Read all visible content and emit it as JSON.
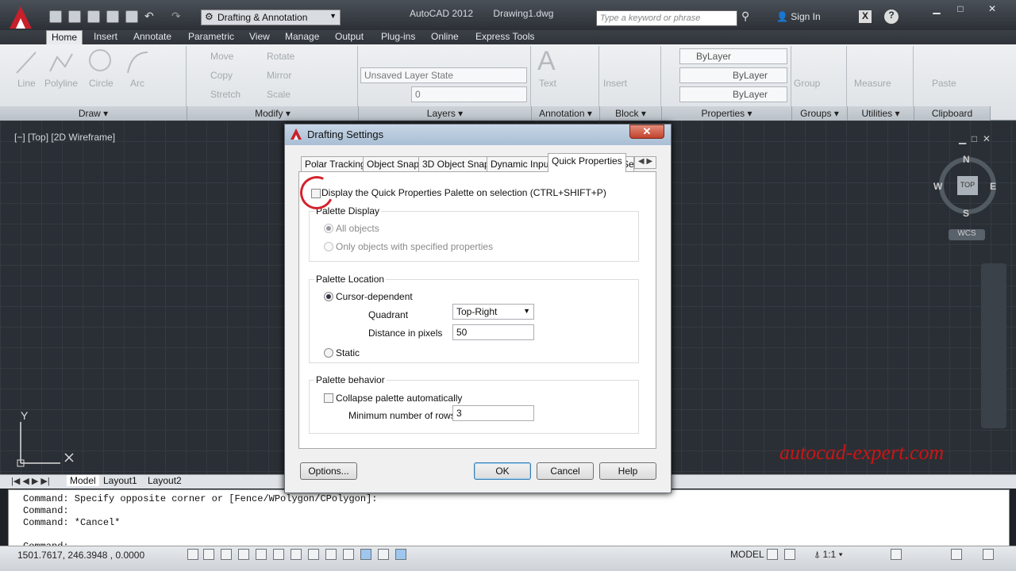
{
  "titlebar": {
    "workspace": "Drafting & Annotation",
    "app_title": "AutoCAD 2012",
    "file_name": "Drawing1.dwg",
    "search_placeholder": "Type a keyword or phrase",
    "sign_in": "Sign In"
  },
  "menu_tabs": [
    "Home",
    "Insert",
    "Annotate",
    "Parametric",
    "View",
    "Manage",
    "Output",
    "Plug-ins",
    "Online",
    "Express Tools"
  ],
  "ribbon": {
    "draw": {
      "line": "Line",
      "polyline": "Polyline",
      "circle": "Circle",
      "arc": "Arc",
      "title": "Draw"
    },
    "modify": {
      "move": "Move",
      "rotate": "Rotate",
      "copy": "Copy",
      "mirror": "Mirror",
      "stretch": "Stretch",
      "scale": "Scale",
      "title": "Modify"
    },
    "layers": {
      "layer_state": "Unsaved Layer State",
      "layer_value": "0",
      "title": "Layers"
    },
    "annotation": {
      "text": "Text",
      "title": "Annotation"
    },
    "block": {
      "insert": "Insert",
      "title": "Block"
    },
    "properties": {
      "color": "ByLayer",
      "linetype": "ByLayer",
      "lineweight": "ByLayer",
      "title": "Properties"
    },
    "groups": {
      "group": "Group",
      "title": "Groups"
    },
    "utilities": {
      "measure": "Measure",
      "title": "Utilities"
    },
    "clipboard": {
      "paste": "Paste",
      "title": "Clipboard"
    }
  },
  "viewport": {
    "label": "[−] [Top] [2D Wireframe]",
    "compass": {
      "n": "N",
      "s": "S",
      "e": "E",
      "w": "W",
      "top": "TOP",
      "wcs": "WCS"
    },
    "axis_y": "Y"
  },
  "layout_tabs": [
    "Model",
    "Layout1",
    "Layout2"
  ],
  "command_lines": [
    "Command: Specify opposite corner or [Fence/WPolygon/CPolygon]:",
    "Command:",
    "Command: *Cancel*",
    "",
    "Command:"
  ],
  "statusbar": {
    "coords": "1501.7617, 246.3948 , 0.0000",
    "model": "MODEL",
    "scale": "1:1"
  },
  "watermark": "autocad-expert.com",
  "dialog": {
    "title": "Drafting Settings",
    "close": "✕",
    "tabs": [
      "Polar Tracking",
      "Object Snap",
      "3D Object Snap",
      "Dynamic Input",
      "Quick Properties",
      "Se"
    ],
    "active_tab": "Quick Properties",
    "display_checkbox": "Display the Quick Properties Palette on selection (CTRL+SHIFT+P)",
    "palette_display": {
      "title": "Palette Display",
      "all_objects": "All objects",
      "only_specified": "Only objects with specified properties"
    },
    "palette_location": {
      "title": "Palette Location",
      "cursor_dependent": "Cursor-dependent",
      "quadrant_label": "Quadrant",
      "quadrant_value": "Top-Right",
      "distance_label": "Distance in pixels",
      "distance_value": "50",
      "static": "Static"
    },
    "palette_behavior": {
      "title": "Palette behavior",
      "collapse": "Collapse palette automatically",
      "min_rows_label": "Minimum number of rows",
      "min_rows_value": "3"
    },
    "buttons": {
      "options": "Options...",
      "ok": "OK",
      "cancel": "Cancel",
      "help": "Help"
    }
  }
}
